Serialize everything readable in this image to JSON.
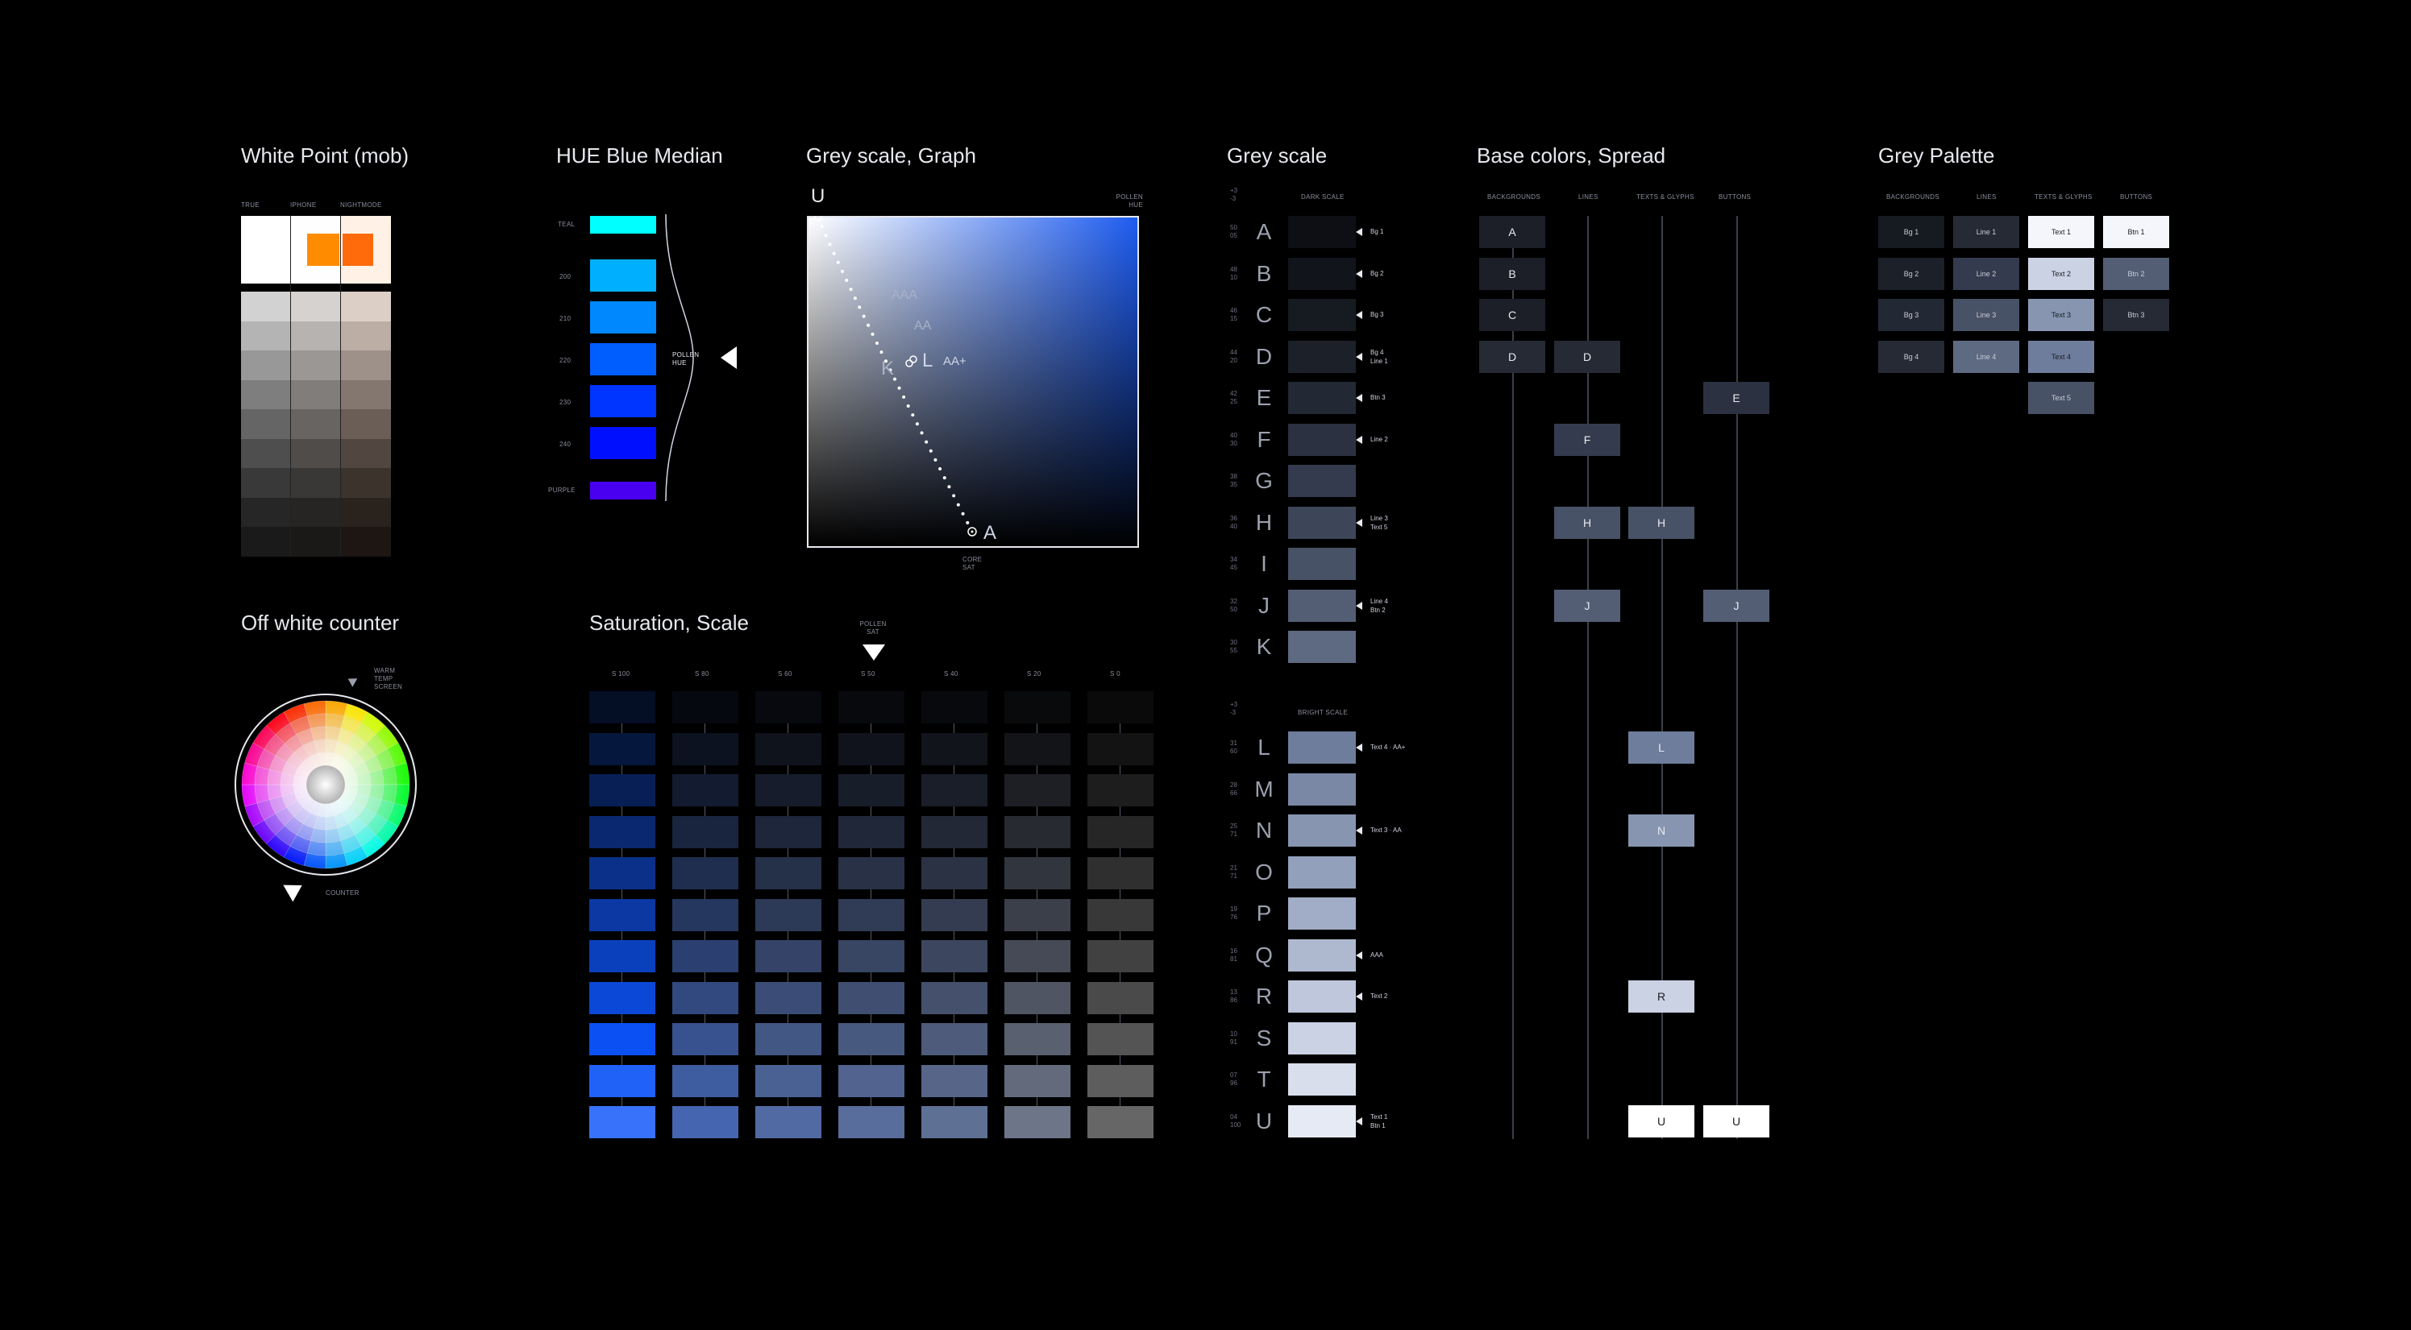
{
  "sections": {
    "white_point": {
      "title": "White Point (mob)",
      "cols": [
        "TRUE",
        "IPHONE",
        "NIGHTMODE"
      ]
    },
    "hue": {
      "title": "HUE Blue Median",
      "rows": [
        "TEAL",
        "200",
        "210",
        "220",
        "230",
        "240",
        "PURPLE"
      ],
      "pollen": "POLLEN HUE"
    },
    "graph": {
      "title": "Grey scale, Graph",
      "u": "U",
      "a": "A",
      "k": "K",
      "l": "L",
      "aaa": "AAA",
      "aa": "AA",
      "aaplus": "AA+",
      "pollen_hue": "POLLEN HUE",
      "core_sat": "CORE SAT"
    },
    "greyscale": {
      "title": "Grey scale",
      "dark_label": "DARK SCALE",
      "bright_label": "BRIGHT SCALE",
      "top_num": "+3 -3"
    },
    "base": {
      "title": "Base colors, Spread",
      "cols": [
        "BACKGROUNDS",
        "LINES",
        "TEXTS & GLYPHS",
        "BUTTONS"
      ]
    },
    "palette": {
      "title": "Grey Palette",
      "cols": [
        "BACKGROUNDS",
        "LINES",
        "TEXTS & GLYPHS",
        "BUTTONS"
      ]
    },
    "offwhite": {
      "title": "Off white counter",
      "warm": "WARM TEMP SCREEN",
      "counter": "COUNTER"
    },
    "saturation": {
      "title": "Saturation, Scale",
      "pollen_sat": "POLLEN SAT",
      "cols": [
        "S 100",
        "S 80",
        "S 60",
        "S 50",
        "S 40",
        "S 20",
        "S 0"
      ]
    }
  },
  "greyscale_rows": [
    {
      "letter": "A",
      "n1": "50",
      "n2": "05",
      "note1": "Bg 1",
      "note2": ""
    },
    {
      "letter": "B",
      "n1": "48",
      "n2": "10",
      "note1": "Bg 2",
      "note2": ""
    },
    {
      "letter": "C",
      "n1": "46",
      "n2": "15",
      "note1": "Bg 3",
      "note2": ""
    },
    {
      "letter": "D",
      "n1": "44",
      "n2": "20",
      "note1": "Bg 4",
      "note2": "Line 1"
    },
    {
      "letter": "E",
      "n1": "42",
      "n2": "25",
      "note1": "Btn 3",
      "note2": ""
    },
    {
      "letter": "F",
      "n1": "40",
      "n2": "30",
      "note1": "Line 2",
      "note2": ""
    },
    {
      "letter": "G",
      "n1": "38",
      "n2": "35",
      "note1": "",
      "note2": ""
    },
    {
      "letter": "H",
      "n1": "36",
      "n2": "40",
      "note1": "Line 3",
      "note2": "Text 5"
    },
    {
      "letter": "I",
      "n1": "34",
      "n2": "45",
      "note1": "",
      "note2": ""
    },
    {
      "letter": "J",
      "n1": "32",
      "n2": "50",
      "note1": "Line 4",
      "note2": "Btn 2"
    },
    {
      "letter": "K",
      "n1": "30",
      "n2": "55",
      "note1": "",
      "note2": ""
    },
    {
      "letter": "L",
      "n1": "31",
      "n2": "60",
      "note1": "Text 4 · AA+",
      "note2": ""
    },
    {
      "letter": "M",
      "n1": "28",
      "n2": "66",
      "note1": "",
      "note2": ""
    },
    {
      "letter": "N",
      "n1": "25",
      "n2": "71",
      "note1": "Text 3 · AA",
      "note2": ""
    },
    {
      "letter": "O",
      "n1": "21",
      "n2": "71",
      "note1": "",
      "note2": ""
    },
    {
      "letter": "P",
      "n1": "19",
      "n2": "76",
      "note1": "",
      "note2": ""
    },
    {
      "letter": "Q",
      "n1": "16",
      "n2": "81",
      "note1": "AAA",
      "note2": ""
    },
    {
      "letter": "R",
      "n1": "13",
      "n2": "86",
      "note1": "Text 2",
      "note2": ""
    },
    {
      "letter": "S",
      "n1": "10",
      "n2": "91",
      "note1": "",
      "note2": ""
    },
    {
      "letter": "T",
      "n1": "07",
      "n2": "96",
      "note1": "",
      "note2": ""
    },
    {
      "letter": "U",
      "n1": "04",
      "n2": "100",
      "note1": "Text 1",
      "note2": "Btn 1"
    }
  ],
  "base_boxes": [
    "A",
    "B",
    "C",
    "D",
    "D",
    "E",
    "F",
    "H",
    "H",
    "J",
    "J",
    "L",
    "N",
    "R",
    "U",
    "U"
  ],
  "palette_cells": [
    "Bg 1",
    "Line 1",
    "Text 1",
    "Btn 1",
    "Bg 2",
    "Line 2",
    "Text 2",
    "Btn 2",
    "Bg 3",
    "Line 3",
    "Text 3",
    "Btn 3",
    "Bg 4",
    "Line 4",
    "Text 4",
    "Text 5"
  ],
  "colors": {
    "accent": "#1e5cf0",
    "bg": "#000000"
  }
}
